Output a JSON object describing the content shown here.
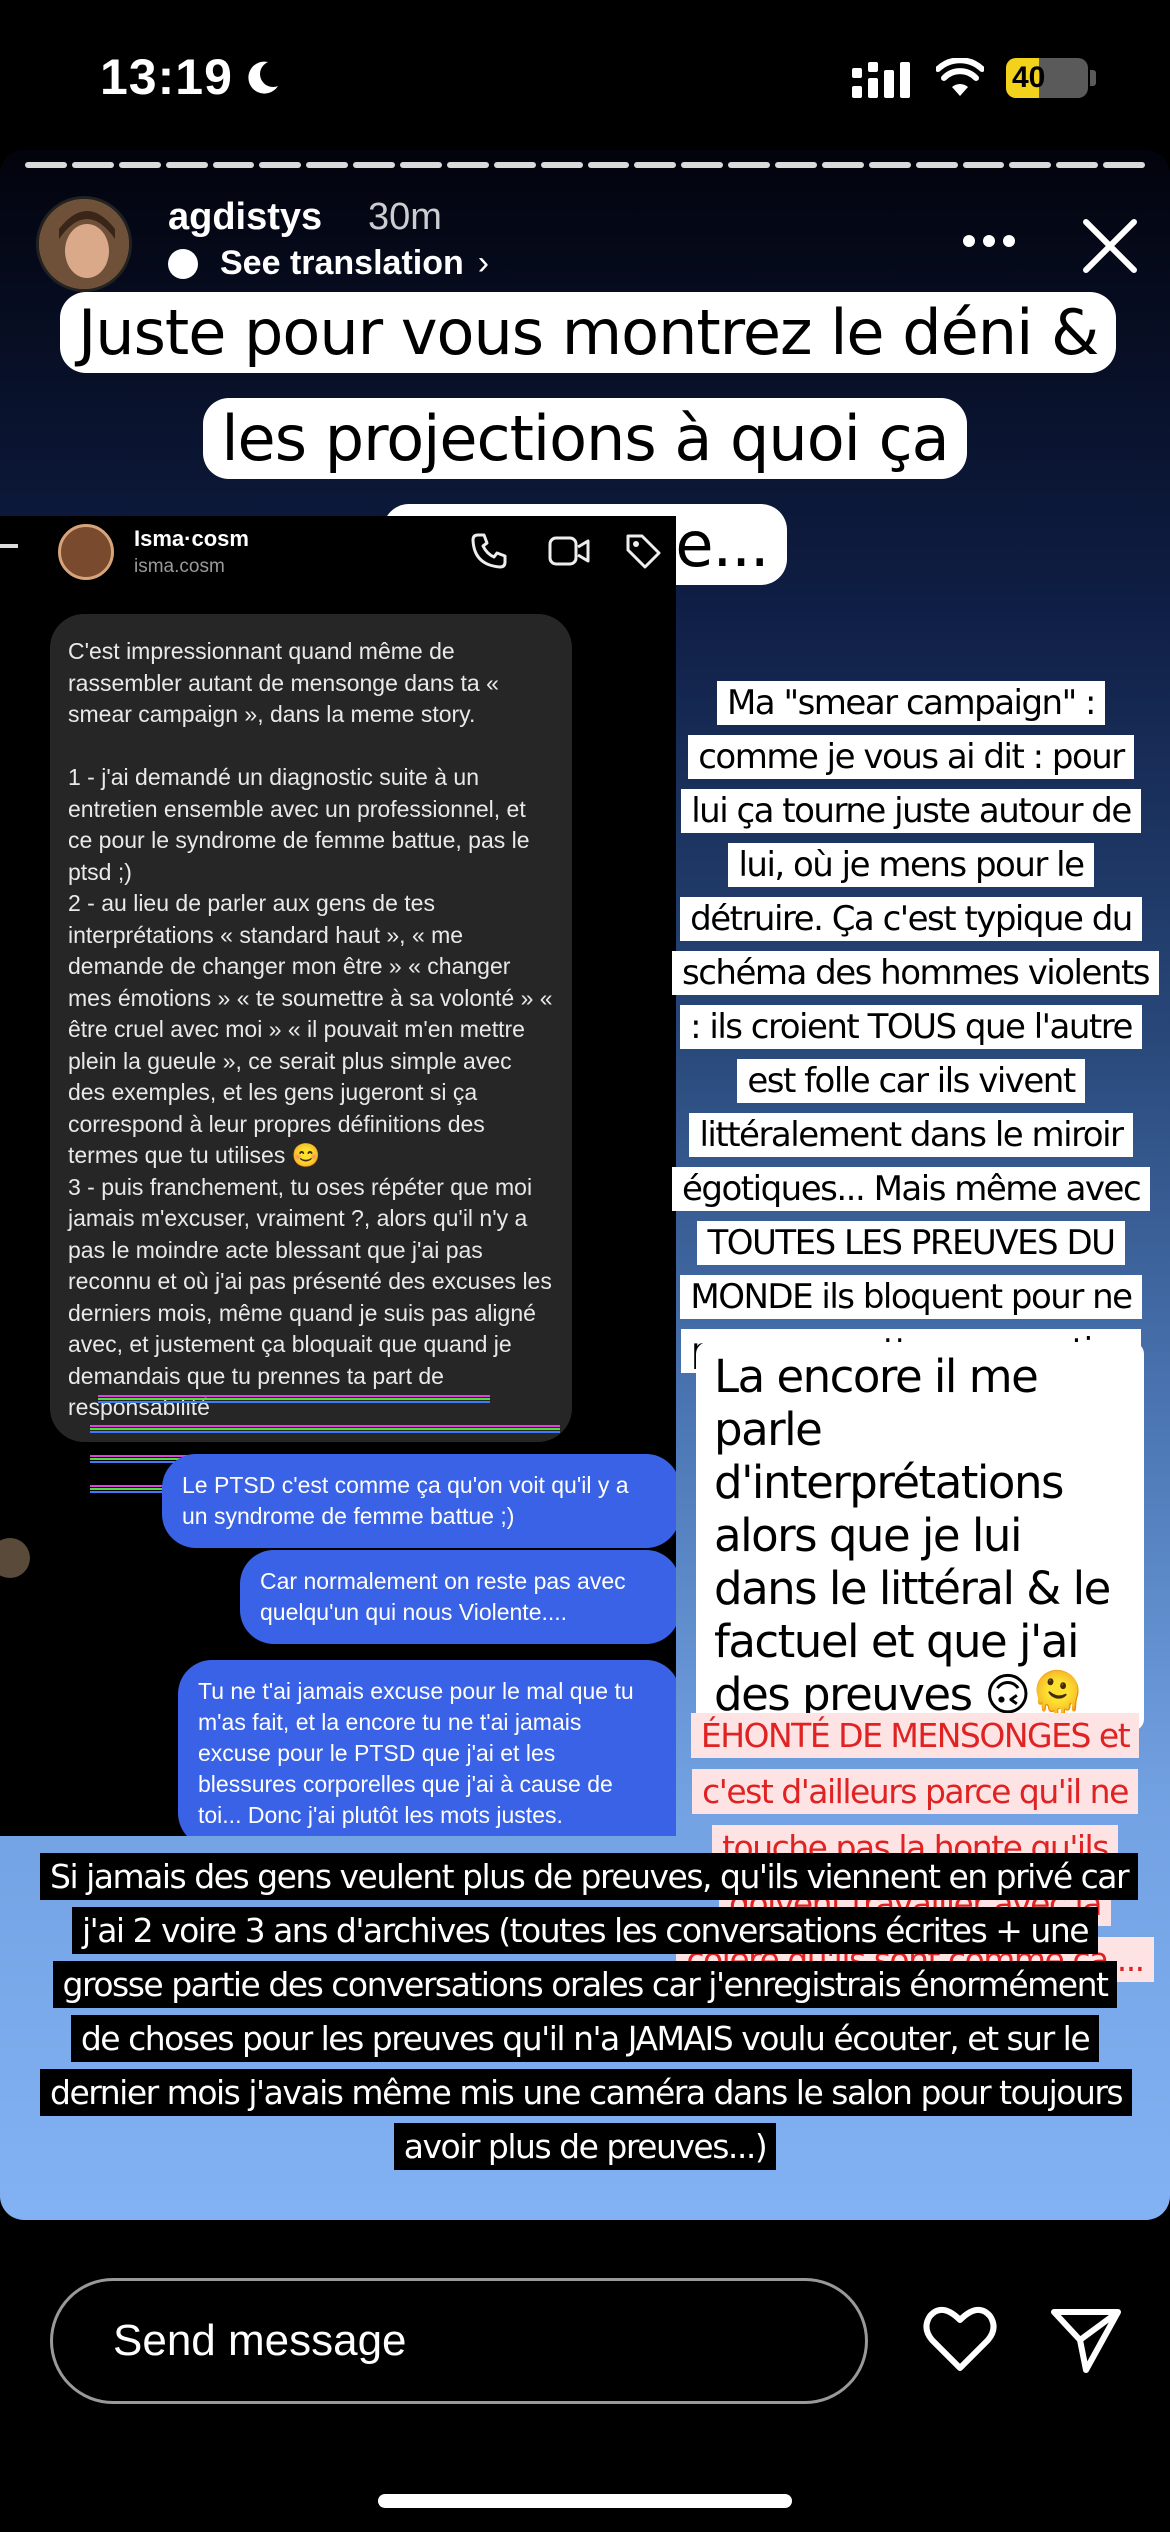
{
  "status_bar": {
    "time": "13:19",
    "battery_text": "40",
    "battery_level_percent": 40,
    "icons": [
      "moon-icon",
      "signal-icon",
      "wifi-icon",
      "battery-icon"
    ]
  },
  "story": {
    "username": "agdistys",
    "time_ago": "30m",
    "see_translation": "See translation",
    "headline": "Juste pour vous montrez le déni & les projections à quoi ça ressemble...",
    "chat": {
      "name": "Isma·cosm",
      "handle": "isma.cosm",
      "received_message": "C'est impressionnant quand même de rassembler autant de mensonge dans ta « smear campaign », dans la meme story.\n\n1 - j'ai demandé un diagnostic suite à un entretien ensemble avec un professionnel, et ce pour le syndrome de femme battue, pas le ptsd ;)\n2 - au lieu de parler aux gens de tes interprétations « standard haut », « me demande de changer mon être » « changer mes émotions » « te soumettre à sa volonté » « être cruel avec moi » « il pouvait m'en mettre plein la gueule », ce serait plus simple avec des exemples, et les gens jugeront si ça correspond à leur propres définitions des termes que tu utilises 😊\n3 - puis franchement, tu oses répéter que moi jamais m'excuser, vraiment ?, alors qu'il n'y a pas le moindre acte blessant que j'ai pas reconnu et où j'ai pas présenté des excuses les derniers mois, même quand je suis pas aligné avec, et justement ça bloquait que quand je demandais que tu prennes ta part de responsabilité",
      "sent_messages": [
        "Le PTSD c'est comme ça qu'on voit qu'il y a un syndrome de femme battue ;)",
        "Car normalement on reste pas avec quelqu'un qui nous Violente....",
        "Tu ne t'ai jamais excuse pour le mal que tu m'as fait, et la encore tu ne t'ai jamais excuse pour le PTSD que j'ai et les blessures corporelles que j'ai à cause de toi... Donc j'ai plutôt les mots justes."
      ],
      "highlight_colors": [
        "#e53be0",
        "#49e23a",
        "#3d7cf5"
      ]
    },
    "note_1": "Ma \"smear campaign\" : comme je vous ai dit : pour lui ça tourne juste autour de lui, où je mens pour le détruire. Ça c'est typique du schéma des hommes violents : ils croient TOUS que l'autre est folle car ils vivent littéralement dans le miroir égotiques... Mais même avec TOUTES LES PREUVES DU MONDE ils bloquent pour ne pas se remettre en question 1 seule seconde.",
    "note_2": "La encore il me parle d'interprétations alors que je lui dans le littéral & le factuel et que j'ai des preuves 🙃🫠",
    "note_3": "ÉHONTÉ DE MENSONGES et c'est d'ailleurs parce qu'il ne touche pas la honte qu'ils doivent travailler avec la colère qu'ils sont comme ça....",
    "caption": "Si jamais des gens veulent plus de preuves, qu'ils viennent en privé car j'ai 2 voire 3 ans d'archives (toutes les conversations écrites + une grosse partie des conversations orales car j'enregistrais énormément de choses pour les preuves qu'il n'a JAMAIS voulu écouter, et sur le dernier mois j'avais même mis une caméra dans le salon pour toujours avoir plus de preuves...)"
  },
  "composer": {
    "placeholder": "Send message"
  },
  "colors": {
    "accent_sent_bubble": "#3a62e6",
    "battery": "#f3d21b",
    "note_red": "#e02222"
  }
}
